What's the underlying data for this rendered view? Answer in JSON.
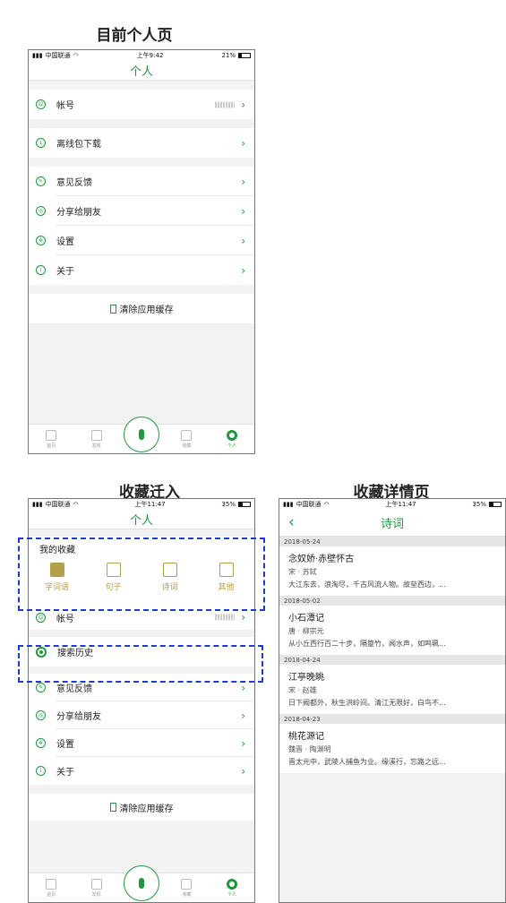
{
  "titles": {
    "current": "目前个人页",
    "migrate": "收藏迁入",
    "detail": "收藏详情页"
  },
  "status1": {
    "carrier": "中国联通",
    "time": "上午9:42",
    "battery": "21%",
    "battery_level": 0.21
  },
  "status2": {
    "carrier": "中国联通",
    "time": "上午11:47",
    "battery": "35%",
    "battery_level": 0.35
  },
  "status3": {
    "carrier": "中国联通",
    "time": "上午11:47",
    "battery": "35%",
    "battery_level": 0.35
  },
  "personal": {
    "nav_title": "个人",
    "account": "帐号",
    "offline": "离线包下载",
    "feedback": "意见反馈",
    "share": "分享给朋友",
    "settings": "设置",
    "about": "关于",
    "clear_cache": "清除应用缓存"
  },
  "tabs": [
    "首页",
    "发现",
    "",
    "收藏",
    "个人"
  ],
  "favorites": {
    "title": "我的收藏",
    "items": [
      "字词语",
      "句子",
      "诗词",
      "其他"
    ]
  },
  "search_history": "搜索历史",
  "detail": {
    "nav_title": "诗词",
    "groups": [
      {
        "date": "2018-05-24",
        "title": "念奴娇·赤壁怀古",
        "author": "宋 · 苏轼",
        "excerpt": "大江东去，浪淘尽，千古风流人物。故垒西边，..."
      },
      {
        "date": "2018-05-02",
        "title": "小石潭记",
        "author": "唐 · 柳宗元",
        "excerpt": "从小丘西行百二十步，隔篁竹，闻水声，如鸣珮..."
      },
      {
        "date": "2018-04-24",
        "title": "江亭晚眺",
        "author": "宋 · 赵雄",
        "excerpt": "日下阙都外，秋生洪岭间。清江无限好，白鸟不..."
      },
      {
        "date": "2018-04-23",
        "title": "桃花源记",
        "author": "魏晋 · 陶渊明",
        "excerpt": "晋太元中，武陵人捕鱼为业。缘溪行，忘路之远..."
      }
    ]
  }
}
